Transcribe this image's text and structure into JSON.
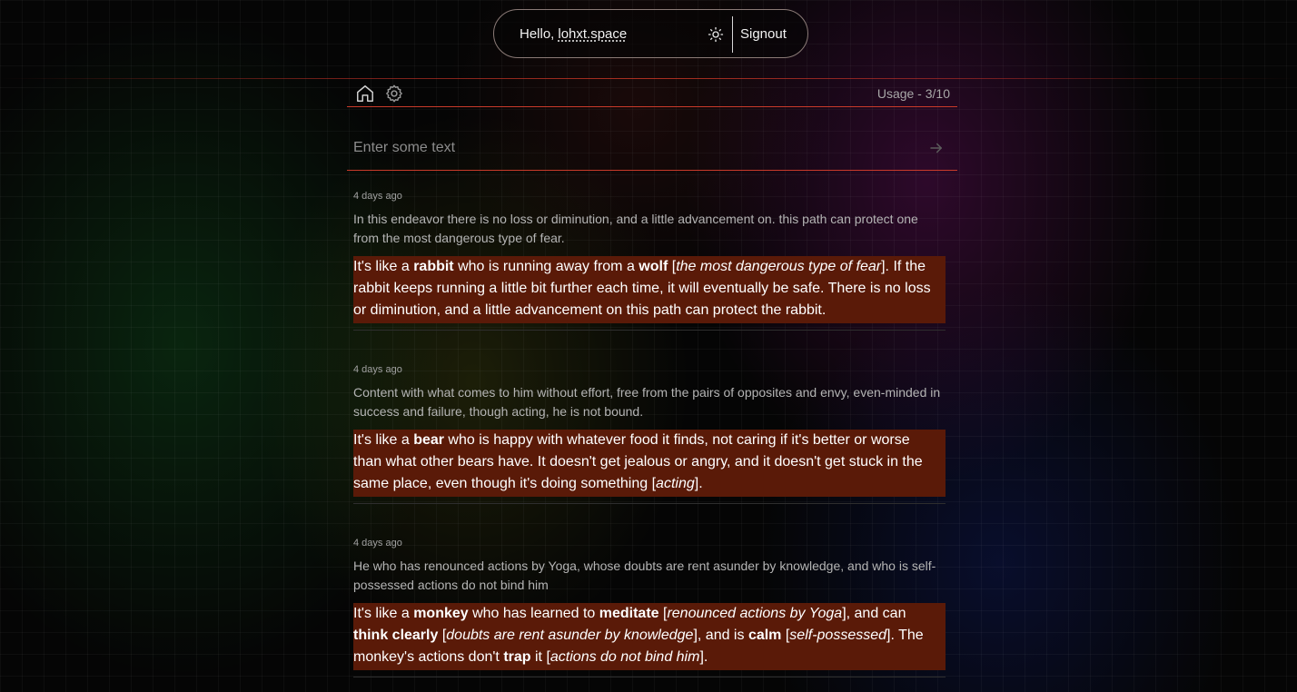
{
  "header": {
    "greeting": "Hello,",
    "username": "lohxt.space",
    "signout_label": "Signout"
  },
  "nav": {
    "usage": "Usage - 3/10"
  },
  "input": {
    "placeholder": "Enter some text"
  },
  "entries": [
    {
      "time": "4 days ago",
      "original": "In this endeavor there is no loss or diminution, and a little advancement on. this path can protect one from the most dangerous type of fear.",
      "analogy": [
        {
          "t": "It's like a "
        },
        {
          "t": "rabbit",
          "b": true
        },
        {
          "t": " who is running away from a "
        },
        {
          "t": "wolf",
          "b": true
        },
        {
          "t": " ["
        },
        {
          "t": "the most dangerous type of fear",
          "i": true
        },
        {
          "t": "]. If the rabbit keeps running a little bit further each time, it will eventually be safe. There is no loss or diminution, and a little advancement on this path can protect the rabbit."
        }
      ]
    },
    {
      "time": "4 days ago",
      "original": "Content with what comes to him without effort, free from the pairs of opposites and envy, even-minded in success and failure, though acting, he is not bound.",
      "analogy": [
        {
          "t": "It's like a "
        },
        {
          "t": "bear",
          "b": true
        },
        {
          "t": " who is happy with whatever food it finds, not caring if it's better or worse than what other bears have. It doesn't get jealous or angry, and it doesn't get stuck in the same place, even though it's doing something ["
        },
        {
          "t": "acting",
          "i": true
        },
        {
          "t": "]."
        }
      ]
    },
    {
      "time": "4 days ago",
      "original": "He who has renounced actions by Yoga, whose doubts are rent asunder by knowledge, and who is self-possessed actions do not bind him",
      "analogy": [
        {
          "t": "It's like a "
        },
        {
          "t": "monkey",
          "b": true
        },
        {
          "t": " who has learned to "
        },
        {
          "t": "meditate",
          "b": true
        },
        {
          "t": " ["
        },
        {
          "t": "renounced actions by Yoga",
          "i": true
        },
        {
          "t": "], and can "
        },
        {
          "t": "think clearly",
          "b": true
        },
        {
          "t": " ["
        },
        {
          "t": "doubts are rent asunder by knowledge",
          "i": true
        },
        {
          "t": "], and is "
        },
        {
          "t": "calm",
          "b": true
        },
        {
          "t": " ["
        },
        {
          "t": "self-possessed",
          "i": true
        },
        {
          "t": "]. The monkey's actions don't "
        },
        {
          "t": "trap",
          "b": true
        },
        {
          "t": " it ["
        },
        {
          "t": "actions do not bind him",
          "i": true
        },
        {
          "t": "]."
        }
      ]
    }
  ]
}
